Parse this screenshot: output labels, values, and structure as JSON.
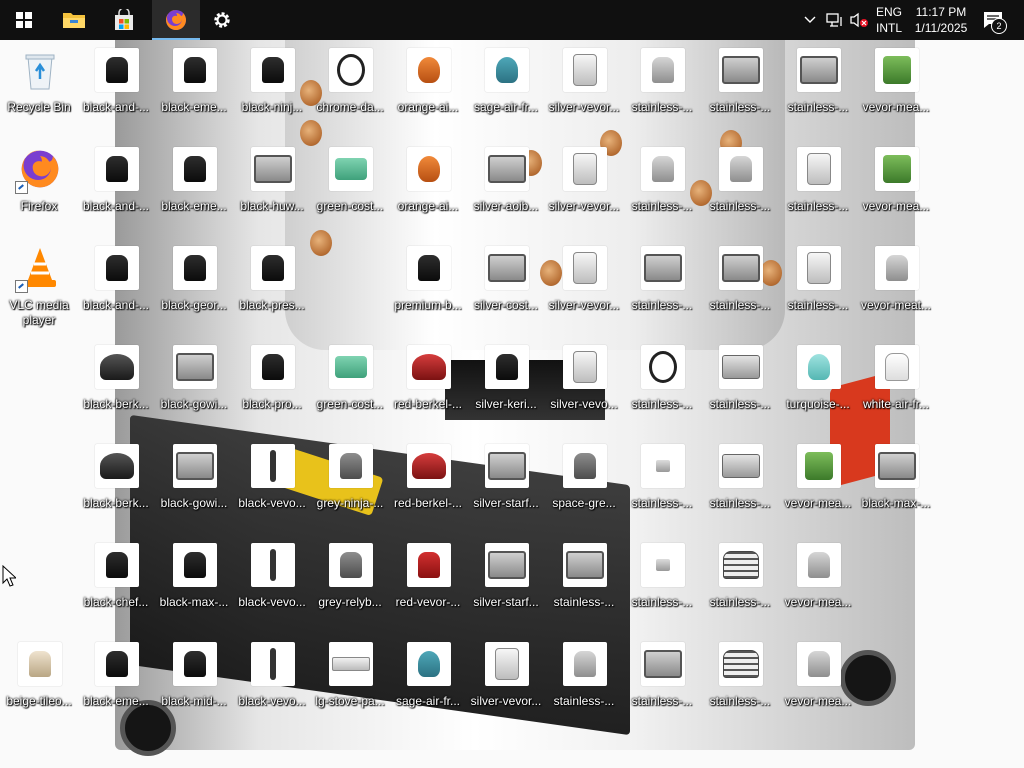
{
  "taskbar": {
    "start_icon": "windows-logo-icon",
    "apps": [
      {
        "name": "file-explorer",
        "icon": "folder-icon"
      },
      {
        "name": "microsoft-store",
        "icon": "store-icon"
      },
      {
        "name": "firefox",
        "icon": "firefox-icon",
        "active": true
      },
      {
        "name": "settings",
        "icon": "gear-icon"
      }
    ],
    "tray": {
      "language_top": "ENG",
      "language_bottom": "INTL",
      "time": "11:17 PM",
      "date": "1/11/2025",
      "notifications_count": "2"
    }
  },
  "desktop": {
    "icons": [
      {
        "label": "Recycle Bin",
        "kind": "recycle"
      },
      {
        "label": "Firefox",
        "kind": "firefox",
        "shortcut": true
      },
      {
        "label": "VLC media player",
        "kind": "vlc",
        "shortcut": true
      },
      {
        "label": "beige-tileo...",
        "kind": "beige"
      },
      {
        "label": "black-and-...",
        "kind": "black"
      },
      {
        "label": "black-and-...",
        "kind": "black"
      },
      {
        "label": "black-and-...",
        "kind": "basket"
      },
      {
        "label": "black-berk...",
        "kind": "slicer"
      },
      {
        "label": "black-berk...",
        "kind": "slicer"
      },
      {
        "label": "black-chef...",
        "kind": "black"
      },
      {
        "label": "black-eme...",
        "kind": "black"
      },
      {
        "label": "black-eme...",
        "kind": "black"
      },
      {
        "label": "black-eme...",
        "kind": "black"
      },
      {
        "label": "black-geor...",
        "kind": "black"
      },
      {
        "label": "black-gowi...",
        "kind": "oven"
      },
      {
        "label": "black-gowi...",
        "kind": "oven"
      },
      {
        "label": "black-max-...",
        "kind": "black"
      },
      {
        "label": "black-max-...",
        "kind": "oven"
      },
      {
        "label": "black-mid-...",
        "kind": "black"
      },
      {
        "label": "black-ninj...",
        "kind": "black"
      },
      {
        "label": "black-huw...",
        "kind": "oven"
      },
      {
        "label": "black-pres...",
        "kind": "black"
      },
      {
        "label": "black-pro...",
        "kind": "black"
      },
      {
        "label": "black-vevo...",
        "kind": "stick"
      },
      {
        "label": "black-vevo...",
        "kind": "stick"
      },
      {
        "label": "black-vevo...",
        "kind": "stick"
      },
      {
        "label": "chrome-da...",
        "kind": "cable"
      },
      {
        "label": "green-cost...",
        "kind": "green"
      },
      {
        "label": "green-cost...",
        "kind": "green"
      },
      {
        "label": "grey-ninja-...",
        "kind": "grey"
      },
      {
        "label": "grey-relyb...",
        "kind": "grey"
      },
      {
        "label": "lg-stove-pa...",
        "kind": "pan"
      },
      {
        "label": "orange-ai...",
        "kind": "orange"
      },
      {
        "label": "orange-ai...",
        "kind": "orange"
      },
      {
        "label": "premium-b...",
        "kind": "black"
      },
      {
        "label": "red-berkel-...",
        "kind": "redslicer"
      },
      {
        "label": "red-berkel-...",
        "kind": "redslicer"
      },
      {
        "label": "red-vevor-...",
        "kind": "red"
      },
      {
        "label": "sage-air-fr...",
        "kind": "teal"
      },
      {
        "label": "sage-air-fr...",
        "kind": "teal"
      },
      {
        "label": "silver-aoib...",
        "kind": "oven"
      },
      {
        "label": "silver-cost...",
        "kind": "oven"
      },
      {
        "label": "silver-keri...",
        "kind": "black"
      },
      {
        "label": "silver-starf...",
        "kind": "oven"
      },
      {
        "label": "silver-starf...",
        "kind": "oven"
      },
      {
        "label": "silver-vevor...",
        "kind": "ice"
      },
      {
        "label": "silver-vevor...",
        "kind": "ice"
      },
      {
        "label": "silver-vevor...",
        "kind": "ice"
      },
      {
        "label": "silver-vevor...",
        "kind": "ice"
      },
      {
        "label": "silver-vevo...",
        "kind": "ice"
      },
      {
        "label": "space-gre...",
        "kind": "grey"
      },
      {
        "label": "stainless-...",
        "kind": "oven"
      },
      {
        "label": "stainless-...",
        "kind": "silver"
      },
      {
        "label": "stainless-...",
        "kind": "silver"
      },
      {
        "label": "stainless-...",
        "kind": "silver"
      },
      {
        "label": "stainless-...",
        "kind": "oven"
      },
      {
        "label": "stainless-...",
        "kind": "cable"
      },
      {
        "label": "stainless-...",
        "kind": "tiny"
      },
      {
        "label": "stainless-...",
        "kind": "tiny"
      },
      {
        "label": "stainless-...",
        "kind": "oven"
      },
      {
        "label": "stainless-...",
        "kind": "oven"
      },
      {
        "label": "stainless-...",
        "kind": "silver"
      },
      {
        "label": "stainless-...",
        "kind": "oven"
      },
      {
        "label": "stainless-...",
        "kind": "display"
      },
      {
        "label": "stainless-...",
        "kind": "display"
      },
      {
        "label": "stainless-...",
        "kind": "rack"
      },
      {
        "label": "stainless-...",
        "kind": "rack"
      },
      {
        "label": "stainless-...",
        "kind": "oven"
      },
      {
        "label": "stainless-...",
        "kind": "ice"
      },
      {
        "label": "stainless-...",
        "kind": "ice"
      },
      {
        "label": "turquoise-...",
        "kind": "turq"
      },
      {
        "label": "vevor-mea...",
        "kind": "meat"
      },
      {
        "label": "vevor-mea...",
        "kind": "silver"
      },
      {
        "label": "vevor-mea...",
        "kind": "silver"
      },
      {
        "label": "vevor-mea...",
        "kind": "meat"
      },
      {
        "label": "vevor-mea...",
        "kind": "meat"
      },
      {
        "label": "vevor-meat...",
        "kind": "silver"
      },
      {
        "label": "white-air-fr...",
        "kind": "white"
      }
    ]
  },
  "colors": {
    "taskbar": "#101010",
    "accent": "#76b9ed"
  }
}
